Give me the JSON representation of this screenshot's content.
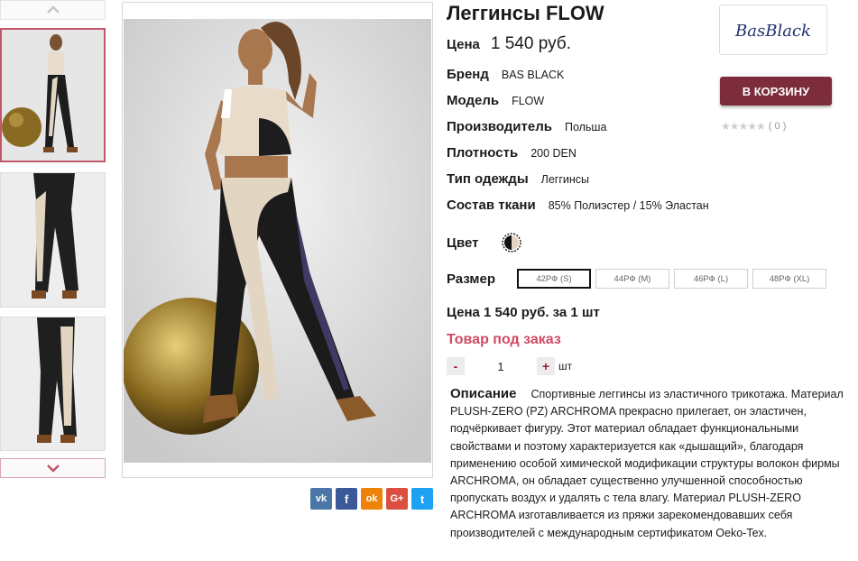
{
  "product": {
    "title": "Леггинсы FLOW",
    "price_label": "Цена",
    "price_value": "1 540 руб."
  },
  "specs": [
    {
      "label": "Бренд",
      "value": "BAS BLACK"
    },
    {
      "label": "Модель",
      "value": "FLOW"
    },
    {
      "label": "Производитель",
      "value": "Польша"
    },
    {
      "label": "Плотность",
      "value": "200 DEN"
    },
    {
      "label": "Тип одежды",
      "value": "Леггинсы"
    },
    {
      "label": "Состав ткани",
      "value": "85% Полиэстер / 15% Эластан"
    }
  ],
  "brand_logo_text": "BasBlack",
  "cart_button": "В КОРЗИНУ",
  "rating": {
    "stars": "★★★★★",
    "count": "( 0 )",
    "value": 0,
    "max": 5
  },
  "color": {
    "label": "Цвет"
  },
  "size": {
    "label": "Размер",
    "options": [
      "42РФ (S)",
      "44РФ (M)",
      "46РФ (L)",
      "48РФ (XL)"
    ],
    "selected": "42РФ (S)"
  },
  "price_per": "Цена 1 540 руб. за 1 шт",
  "order_status": "Товар под заказ",
  "quantity": {
    "minus": "-",
    "value": "1",
    "plus": "+",
    "unit": "шт"
  },
  "share": [
    {
      "name": "vk",
      "glyph": "vk",
      "color": "#4a76a8"
    },
    {
      "name": "facebook",
      "glyph": "f",
      "color": "#3b5998"
    },
    {
      "name": "odnoklassniki",
      "glyph": "ok",
      "color": "#ee8208"
    },
    {
      "name": "google-plus",
      "glyph": "G+",
      "color": "#dc4e41"
    },
    {
      "name": "twitter",
      "glyph": "t",
      "color": "#1da1f2"
    }
  ],
  "description": {
    "title": "Описание",
    "text": "Спортивные леггинсы из эластичного трикотажа. Материал PLUSH-ZERO (PZ) ARCHROMA прекрасно прилегает, он эластичен, подчёркивает фигуру. Этот материал обладает функциональными свойствами и поэтому характеризуется как «дышащий», благодаря применению особой химической модификации структуры волокон фирмы ARCHROMA, он обладает существенно улучшенной способностью пропускать воздух и удалять с тела влагу. Материал PLUSH-ZERO ARCHROMA изготавливается из пряжи зарекомендовавших себя производителей с международным сертификатом Oeko-Tex."
  },
  "colors": {
    "accent": "#7c2c3a",
    "status": "#cf4a64",
    "active_border": "#c2566a"
  }
}
